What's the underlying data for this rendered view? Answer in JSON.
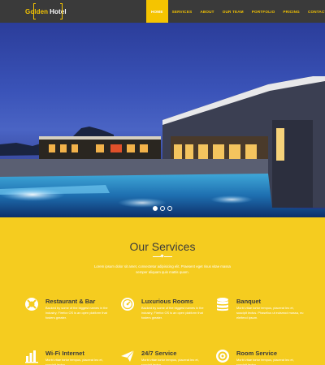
{
  "brand": {
    "word1": "Golden",
    "word2": "Hotel"
  },
  "nav": {
    "items": [
      {
        "label": "HOME",
        "active": true
      },
      {
        "label": "SERVICES",
        "active": false
      },
      {
        "label": "ABOUT",
        "active": false
      },
      {
        "label": "OUR TEAM",
        "active": false
      },
      {
        "label": "PORTFOLIO",
        "active": false
      },
      {
        "label": "PRICING",
        "active": false
      },
      {
        "label": "CONTACT",
        "active": false
      }
    ]
  },
  "slider": {
    "slide_count": 3,
    "active_index": 0
  },
  "services": {
    "title": "Our Services",
    "intro": "Lorem ipsum dolor sit amet, consectetur adipisicing elit. Praesent eget risus vitae massa semper aliquam quis mattis quam.",
    "items": [
      {
        "icon": "life-ring-icon",
        "title": "Restaurant & Bar",
        "desc": "Backed by some of the biggest names in the industry, Firefox OS is an open platform that fosters greater."
      },
      {
        "icon": "gauge-icon",
        "title": "Luxurious Rooms",
        "desc": "Backed by some of the biggest names in the industry, Firefox OS is an open platform that fosters greater."
      },
      {
        "icon": "database-icon",
        "title": "Banquet",
        "desc": "Morbi vitae tortor tempus, placerat leo et, suscipit lectus. Phasellus ut euismod massa, eu eleifend ipsum."
      },
      {
        "icon": "bar-chart-icon",
        "title": "Wi-Fi Internet",
        "desc": "Morbi vitae tortor tempus, placerat leo et, suscipit lectus."
      },
      {
        "icon": "paper-plane-icon",
        "title": "24/7 Service",
        "desc": "Morbi vitae tortor tempus, placerat leo et, suscipit lectus."
      },
      {
        "icon": "bullseye-icon",
        "title": "Room Service",
        "desc": "Morbi vitae tortor tempus, placerat leo et, suscipit lectus."
      }
    ]
  },
  "colors": {
    "accent": "#f5c400",
    "header_bg": "#3a3a3a",
    "section_bg": "#f5cc1f",
    "heading": "#3b3b3b"
  }
}
